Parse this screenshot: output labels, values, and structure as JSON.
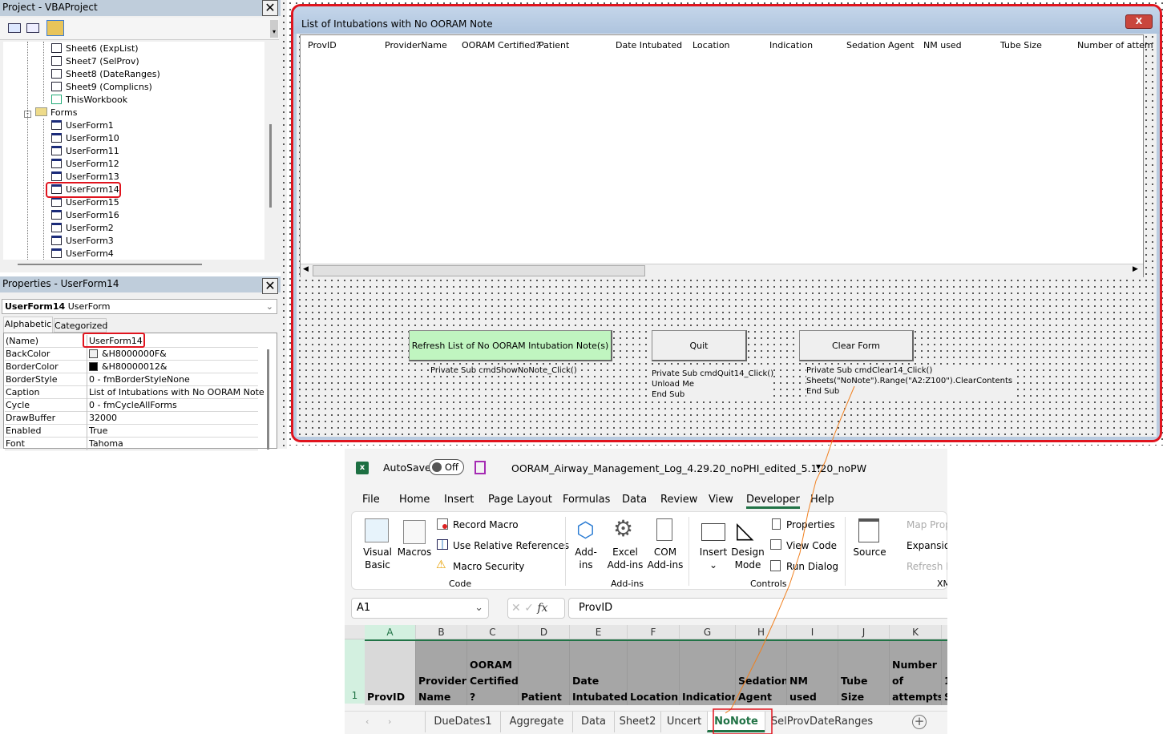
{
  "project": {
    "title": "Project - VBAProject",
    "close": "✕",
    "items": [
      {
        "label": "Sheet6 (ExpList)",
        "type": "sheet"
      },
      {
        "label": "Sheet7 (SelProv)",
        "type": "sheet"
      },
      {
        "label": "Sheet8 (DateRanges)",
        "type": "sheet"
      },
      {
        "label": "Sheet9 (Complicns)",
        "type": "sheet"
      },
      {
        "label": "ThisWorkbook",
        "type": "workbook"
      }
    ],
    "forms_label": "Forms",
    "forms": [
      "UserForm1",
      "UserForm10",
      "UserForm11",
      "UserForm12",
      "UserForm13",
      "UserForm14",
      "UserForm15",
      "UserForm16",
      "UserForm2",
      "UserForm3",
      "UserForm4"
    ],
    "selected_form": "UserForm14"
  },
  "properties": {
    "title": "Properties - UserForm14",
    "close": "✕",
    "object_name": "UserForm14",
    "object_type": "UserForm",
    "tabs": [
      "Alphabetic",
      "Categorized"
    ],
    "rows": [
      {
        "k": "(Name)",
        "v": "UserForm14"
      },
      {
        "k": "BackColor",
        "v": "&H8000000F&",
        "swatch": "#f0f0f0"
      },
      {
        "k": "BorderColor",
        "v": "&H80000012&",
        "swatch": "#000000"
      },
      {
        "k": "BorderStyle",
        "v": "0 - fmBorderStyleNone"
      },
      {
        "k": "Caption",
        "v": "List of Intubations with No OORAM Note"
      },
      {
        "k": "Cycle",
        "v": "0 - fmCycleAllForms"
      },
      {
        "k": "DrawBuffer",
        "v": "32000"
      },
      {
        "k": "Enabled",
        "v": "True"
      },
      {
        "k": "Font",
        "v": "Tahoma"
      }
    ]
  },
  "form": {
    "caption": "List of Intubations with No OORAM Note",
    "close": "X",
    "list_headers": [
      "ProvID",
      "ProviderName",
      "OORAM Certified?",
      "Patient",
      "Date Intubated",
      "Location",
      "Indication",
      "Sedation Agent",
      "NM used",
      "Tube Size",
      "Number of attem"
    ],
    "buttons": {
      "refresh": "Refresh List of No OORAM Intubation Note(s)",
      "quit": "Quit",
      "clear": "Clear Form"
    },
    "refresh_color": "#c0f5c0",
    "code": {
      "refresh": [
        "Private Sub cmdShowNoNote_Click()"
      ],
      "quit": [
        "Private Sub cmdQuit14_Click()",
        "Unload Me",
        "End Sub"
      ],
      "clear": [
        "Private Sub cmdClear14_Click()",
        "Sheets(\"NoNote\").Range(\"A2:Z100\").ClearContents",
        "End Sub"
      ]
    }
  },
  "excel": {
    "autosave": "AutoSave",
    "autosave_state": "Off",
    "filename": "OORAM_Airway_Management_Log_4.29.20_noPHI_edited_5.1.20_noPW",
    "menu": [
      "File",
      "Home",
      "Insert",
      "Page Layout",
      "Formulas",
      "Data",
      "Review",
      "View",
      "Developer",
      "Help"
    ],
    "active_menu": "Developer",
    "ribbon": {
      "visual_basic": [
        "Visual",
        "Basic"
      ],
      "macros": "Macros",
      "record_macro": "Record Macro",
      "use_relative": "Use Relative References",
      "macro_security": "Macro Security",
      "code_group": "Code",
      "addins": [
        "Add-",
        "ins"
      ],
      "excel_addins": [
        "Excel",
        "Add-ins"
      ],
      "com_addins": [
        "COM",
        "Add-ins"
      ],
      "addins_group": "Add-ins",
      "insert": "Insert",
      "design_mode": [
        "Design",
        "Mode"
      ],
      "properties": "Properties",
      "view_code": "View Code",
      "run_dialog": "Run Dialog",
      "controls_group": "Controls",
      "source": "Source",
      "map_prop": "Map Prop",
      "expansion": "Expansion",
      "refresh_d": "Refresh D",
      "xml_group": "XM"
    },
    "name_box": "A1",
    "formula": "ProvID",
    "fx": "fx",
    "columns": [
      "A",
      "B",
      "C",
      "D",
      "E",
      "F",
      "G",
      "H",
      "I",
      "J",
      "K"
    ],
    "row_number": "1",
    "header_cells": [
      [
        "ProvID"
      ],
      [
        "Provider",
        "Name"
      ],
      [
        "OORAM",
        "Certified",
        "?"
      ],
      [
        "Patient"
      ],
      [
        "Date",
        "Intubated"
      ],
      [
        "Location"
      ],
      [
        "Indication"
      ],
      [
        "Sedation",
        "Agent"
      ],
      [
        "NM used"
      ],
      [
        "Tube Size"
      ],
      [
        "Number",
        "of",
        "attempts"
      ],
      [
        "1",
        "S"
      ]
    ],
    "sheet_tabs": [
      "DueDates1",
      "Aggregate",
      "Data",
      "Sheet2",
      "Uncert",
      "NoNote",
      "SelProvDateRanges"
    ],
    "active_tab": "NoNote",
    "accent": "#217346"
  }
}
